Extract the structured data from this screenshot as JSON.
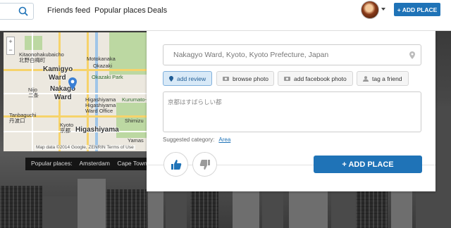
{
  "nav": {
    "links": [
      "Friends feed",
      "Popular places",
      "Deals"
    ],
    "add_place_label": "+ ADD PLACE"
  },
  "map": {
    "labels": {
      "kitaonohakubaicho": "Kitaonohakubaicho",
      "kitaono_jp": "北野白梅町",
      "motokanaka": "Motokanaka",
      "okazaki": "Okazaki",
      "okazaki_park": "Okazaki Park",
      "kamigyo": "Kamigyo",
      "ward1": "Ward",
      "nakagyo": "Nakago",
      "ward2": "Ward",
      "nijo": "Nijo",
      "nijo_jp": "二条",
      "tanbaguchi": "Tanbaguchi",
      "tanbaguchi_jp": "丹波口",
      "kyoto": "Kyoto",
      "kyoto_jp": "京都",
      "higashiyama_ward_office": "Higashiyama Ward Office",
      "higashiyama1": "Higashiyama",
      "higashiyama2": "Higashiyama",
      "shimizu": "Shimizu",
      "yamashina": "Yamas",
      "kurumatoyama": "Kurumato-yama"
    },
    "credit": "Map data ©2014 Google, ZENRIN   Terms of Use"
  },
  "popular": {
    "label": "Popular places:",
    "items": [
      "Amsterdam",
      "Cape Town"
    ]
  },
  "panel": {
    "location_value": "Nakagyo Ward, Kyoto, Kyoto Prefecture, Japan",
    "tabs": [
      "add review",
      "browse photo",
      "add facebook photo",
      "tag a friend"
    ],
    "review_text": "京都はすばらしい都",
    "suggested_label": "Suggested category:",
    "suggested_value": "Area",
    "add_place_label": "+ ADD PLACE"
  },
  "colors": {
    "accent": "#1f73b7",
    "active_tab_bg": "#d8e9f7"
  }
}
